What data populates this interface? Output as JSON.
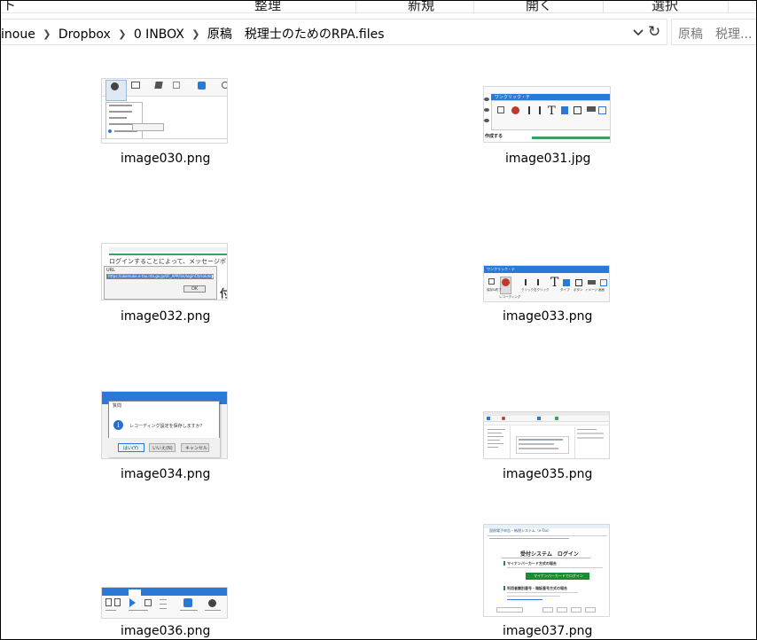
{
  "ribbon": {
    "items": [
      "ト",
      "整理",
      "新規",
      "開く",
      "選択"
    ]
  },
  "address": {
    "crumbs": [
      "inoue",
      "Dropbox",
      "0 INBOX",
      "原稿　税理士のためのRPA.files"
    ]
  },
  "search": {
    "placeholder": "原稿　税理..."
  },
  "files": [
    {
      "name": "image030.png"
    },
    {
      "name": "image031.jpg"
    },
    {
      "name": "image032.png"
    },
    {
      "name": "image033.png"
    },
    {
      "name": "image034.png"
    },
    {
      "name": "image035.png"
    },
    {
      "name": "image036.png"
    },
    {
      "name": "image037.png"
    }
  ],
  "thumbs": {
    "t032": {
      "url_label": "URL",
      "url_value": "https://ukemuke.e-tax.nta.go.jp/UF_APP/lnk/loginCtl/solution",
      "ok": "OK",
      "line1": "ログインすることによって、メッセージボックスやe",
      "char": "付"
    },
    "t033": {
      "title": "ワンクリック・テ",
      "items": [
        "保存&終了",
        "レコーディング",
        "クリック",
        "右クリック",
        "文字",
        "タイプ",
        "ボタン",
        "テキスト",
        "画像",
        "イメージ",
        "画面"
      ]
    },
    "t034": {
      "title": "質問",
      "message": "レコーディング設定を保存しますか？",
      "yes": "はい(Y)",
      "no": "いいえ(N)",
      "cancel": "キャンセル"
    },
    "t031": {
      "title": "ワンクリック・テ",
      "footer": "作成する"
    },
    "t037": {
      "header": "国税電子申告・納税システム（e-Tax）",
      "title": "受付システム　ログイン",
      "section1": "マイナンバーカード方式の場合",
      "button": "マイナンバーカードでログイン",
      "section2": "利用者識別番号・暗証番号方式の場合"
    }
  }
}
